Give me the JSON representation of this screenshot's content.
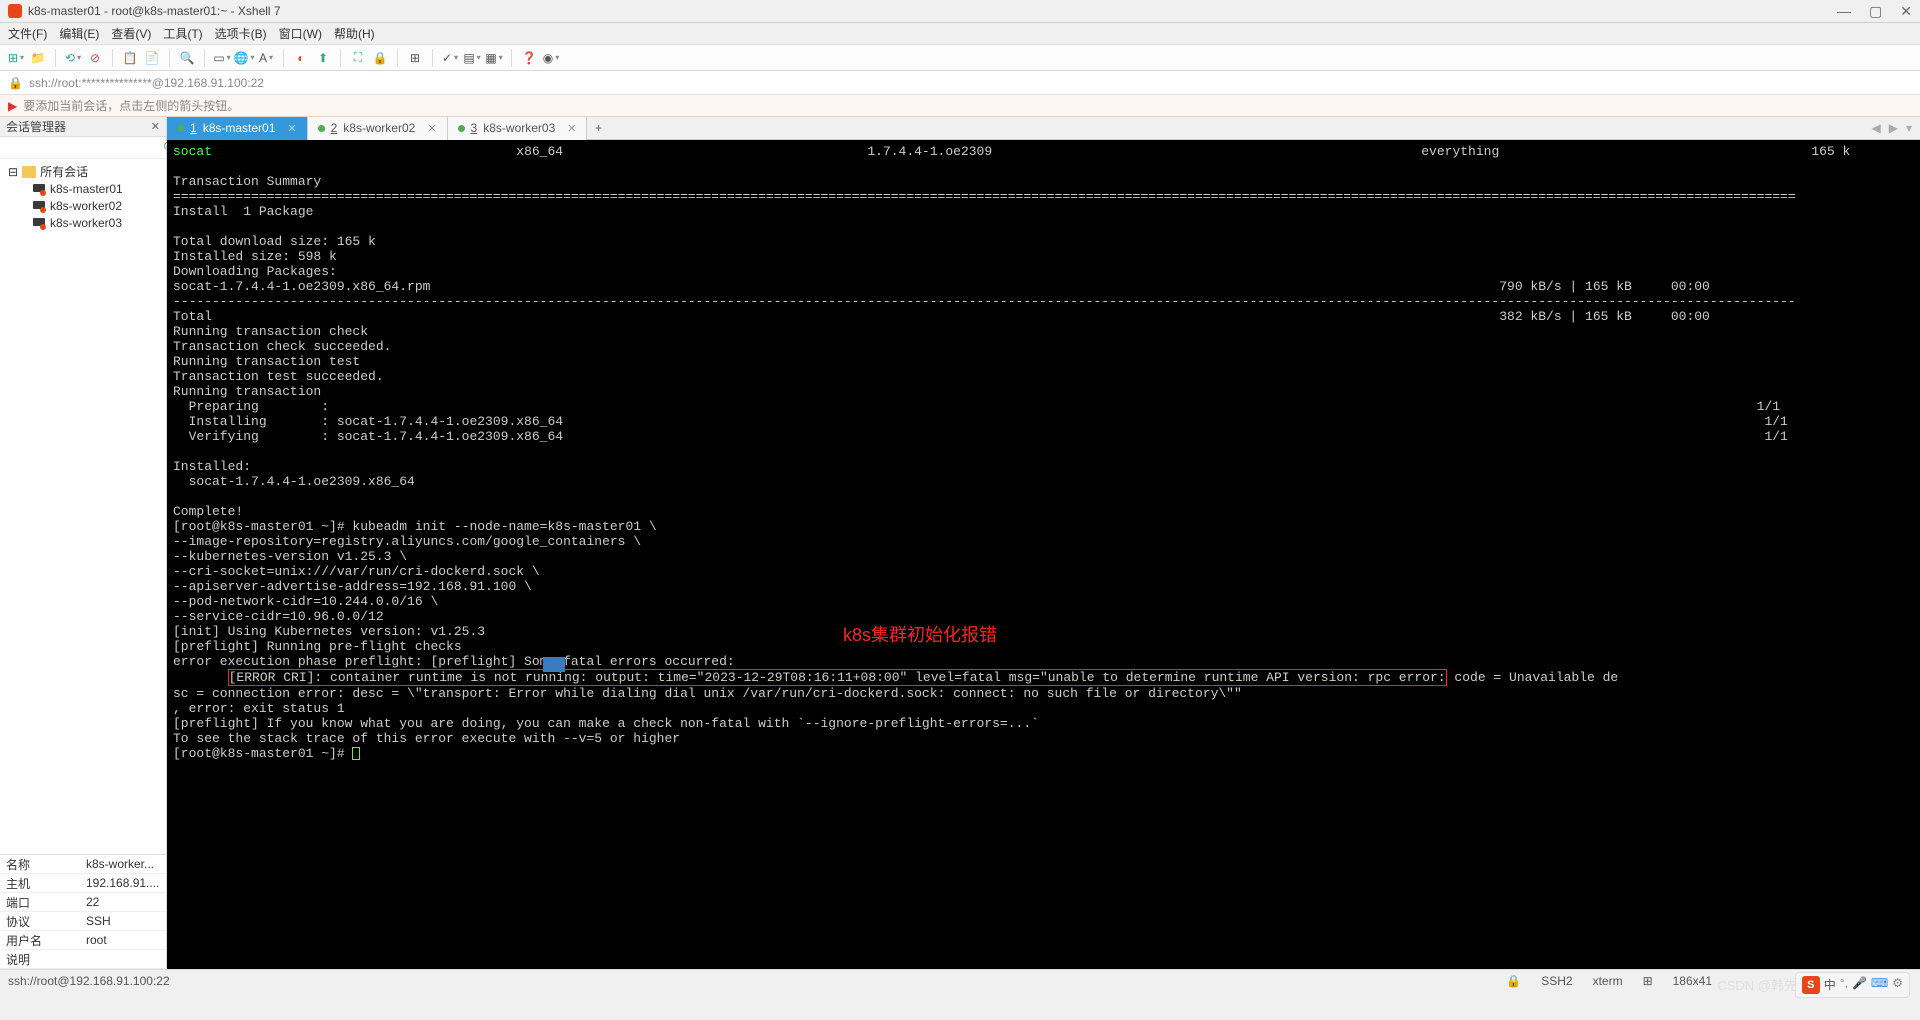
{
  "window": {
    "title": "k8s-master01 - root@k8s-master01:~ - Xshell 7"
  },
  "menu": {
    "file": "文件(F)",
    "edit": "编辑(E)",
    "view": "查看(V)",
    "tools": "工具(T)",
    "tab": "选项卡(B)",
    "window": "窗口(W)",
    "help": "帮助(H)"
  },
  "address": {
    "text": "ssh://root:***************@192.168.91.100:22"
  },
  "hint": {
    "text": "要添加当前会话，点击左侧的箭头按钮。"
  },
  "sidebar": {
    "title": "会话管理器",
    "root": "所有会话",
    "items": [
      "k8s-master01",
      "k8s-worker02",
      "k8s-worker03"
    ]
  },
  "props": [
    {
      "label": "名称",
      "value": "k8s-worker..."
    },
    {
      "label": "主机",
      "value": "192.168.91...."
    },
    {
      "label": "端口",
      "value": "22"
    },
    {
      "label": "协议",
      "value": "SSH"
    },
    {
      "label": "用户名",
      "value": "root"
    },
    {
      "label": "说明",
      "value": ""
    }
  ],
  "tabs": [
    {
      "num": "1",
      "label": "k8s-master01",
      "active": true
    },
    {
      "num": "2",
      "label": "k8s-worker02",
      "active": false
    },
    {
      "num": "3",
      "label": "k8s-worker03",
      "active": false
    }
  ],
  "terminal": {
    "header_pkg": "socat",
    "header_arch": "x86_64",
    "header_ver": "1.7.4.4-1.oe2309",
    "header_repo": "everything",
    "header_size": "165 k",
    "tx_summary": "Transaction Summary",
    "divider1": "================================================================================================================================================================================================================",
    "install_line": "Install  1 Package",
    "dl_size": "Total download size: 165 k",
    "inst_size": "Installed size: 598 k",
    "dl_pkg": "Downloading Packages:",
    "rpm_line": "socat-1.7.4.4-1.oe2309.x86_64.rpm                                                                                                                                         790 kB/s | 165 kB     00:00",
    "dashes": "----------------------------------------------------------------------------------------------------------------------------------------------------------------------------------------------------------------",
    "total_line": "Total                                                                                                                                                                     382 kB/s | 165 kB     00:00",
    "tx1": "Running transaction check",
    "tx2": "Transaction check succeeded.",
    "tx3": "Running transaction test",
    "tx4": "Transaction test succeeded.",
    "tx5": "Running transaction",
    "prep": "  Preparing        :                                                                                                                                                                                       1/1",
    "inst": "  Installing       : socat-1.7.4.4-1.oe2309.x86_64                                                                                                                                                          1/1",
    "verf": "  Verifying        : socat-1.7.4.4-1.oe2309.x86_64                                                                                                                                                          1/1",
    "installed": "Installed:",
    "inst_pkg": "  socat-1.7.4.4-1.oe2309.x86_64",
    "complete": "Complete!",
    "prompt1": "[root@k8s-master01 ~]# kubeadm init --node-name=k8s-master01 \\",
    "cmd1": "--image-repository=registry.aliyuncs.com/google_containers \\",
    "cmd2": "--kubernetes-version v1.25.3 \\",
    "cmd3": "--cri-socket=unix:///var/run/cri-dockerd.sock \\",
    "cmd4": "--apiserver-advertise-address=192.168.91.100 \\",
    "cmd5": "--pod-network-cidr=10.244.0.0/16 \\",
    "cmd6": "--service-cidr=10.96.0.0/12",
    "init1": "[init] Using Kubernetes version: v1.25.3",
    "init2": "[preflight] Running pre-flight checks",
    "init3": "error execution phase preflight: [preflight] Some fatal errors occurred:",
    "errbox": "[ERROR CRI]: container runtime is not running: output: time=\"2023-12-29T08:16:11+08:00\" level=fatal msg=\"unable to determine runtime API version: rpc error:",
    "err_pre": "       ",
    "err_post": " code = Unavailable de",
    "err2": "sc = connection error: desc = \\\"transport: Error while dialing dial unix /var/run/cri-dockerd.sock: connect: no such file or directory\\\"\"",
    "err3": ", error: exit status 1",
    "err4": "[preflight] If you know what you are doing, you can make a check non-fatal with `--ignore-preflight-errors=...`",
    "err5": "To see the stack trace of this error execute with --v=5 or higher",
    "prompt2": "[root@k8s-master01 ~]# ",
    "annotation": "k8s集群初始化报错"
  },
  "status": {
    "left": "ssh://root@192.168.91.100:22",
    "ssh": "SSH2",
    "term": "xterm",
    "size": "186x41",
    "pos_icon": "⊞"
  },
  "watermark": "CSDN @韩先超"
}
